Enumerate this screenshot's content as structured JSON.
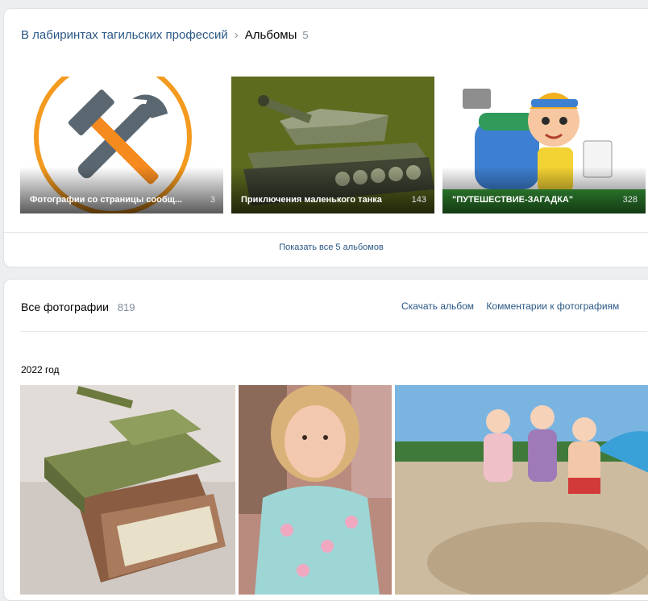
{
  "albums_section": {
    "breadcrumb_group": "В лабиринтах тагильских профессий",
    "breadcrumb_separator": "›",
    "breadcrumb_current": "Альбомы",
    "album_count": "5",
    "albums": [
      {
        "title": "Фотографии со страницы сообщ...",
        "count": "3",
        "icon": "tools-icon"
      },
      {
        "title": "Приключения маленького танка",
        "count": "143",
        "icon": "tank-icon"
      },
      {
        "title": "\"ПУТЕШЕСТВИЕ-ЗАГАДКА\"",
        "count": "328",
        "icon": "traveler-boy-icon"
      }
    ],
    "show_all_label": "Показать все 5 альбомов"
  },
  "photos_section": {
    "title": "Все фотографии",
    "count": "819",
    "download_label": "Скачать альбом",
    "comments_label": "Комментарии к фотографиям",
    "year_label": "2022 год"
  },
  "colors": {
    "link": "#2a5885",
    "muted": "#818c99",
    "page_bg": "#edeef0"
  }
}
